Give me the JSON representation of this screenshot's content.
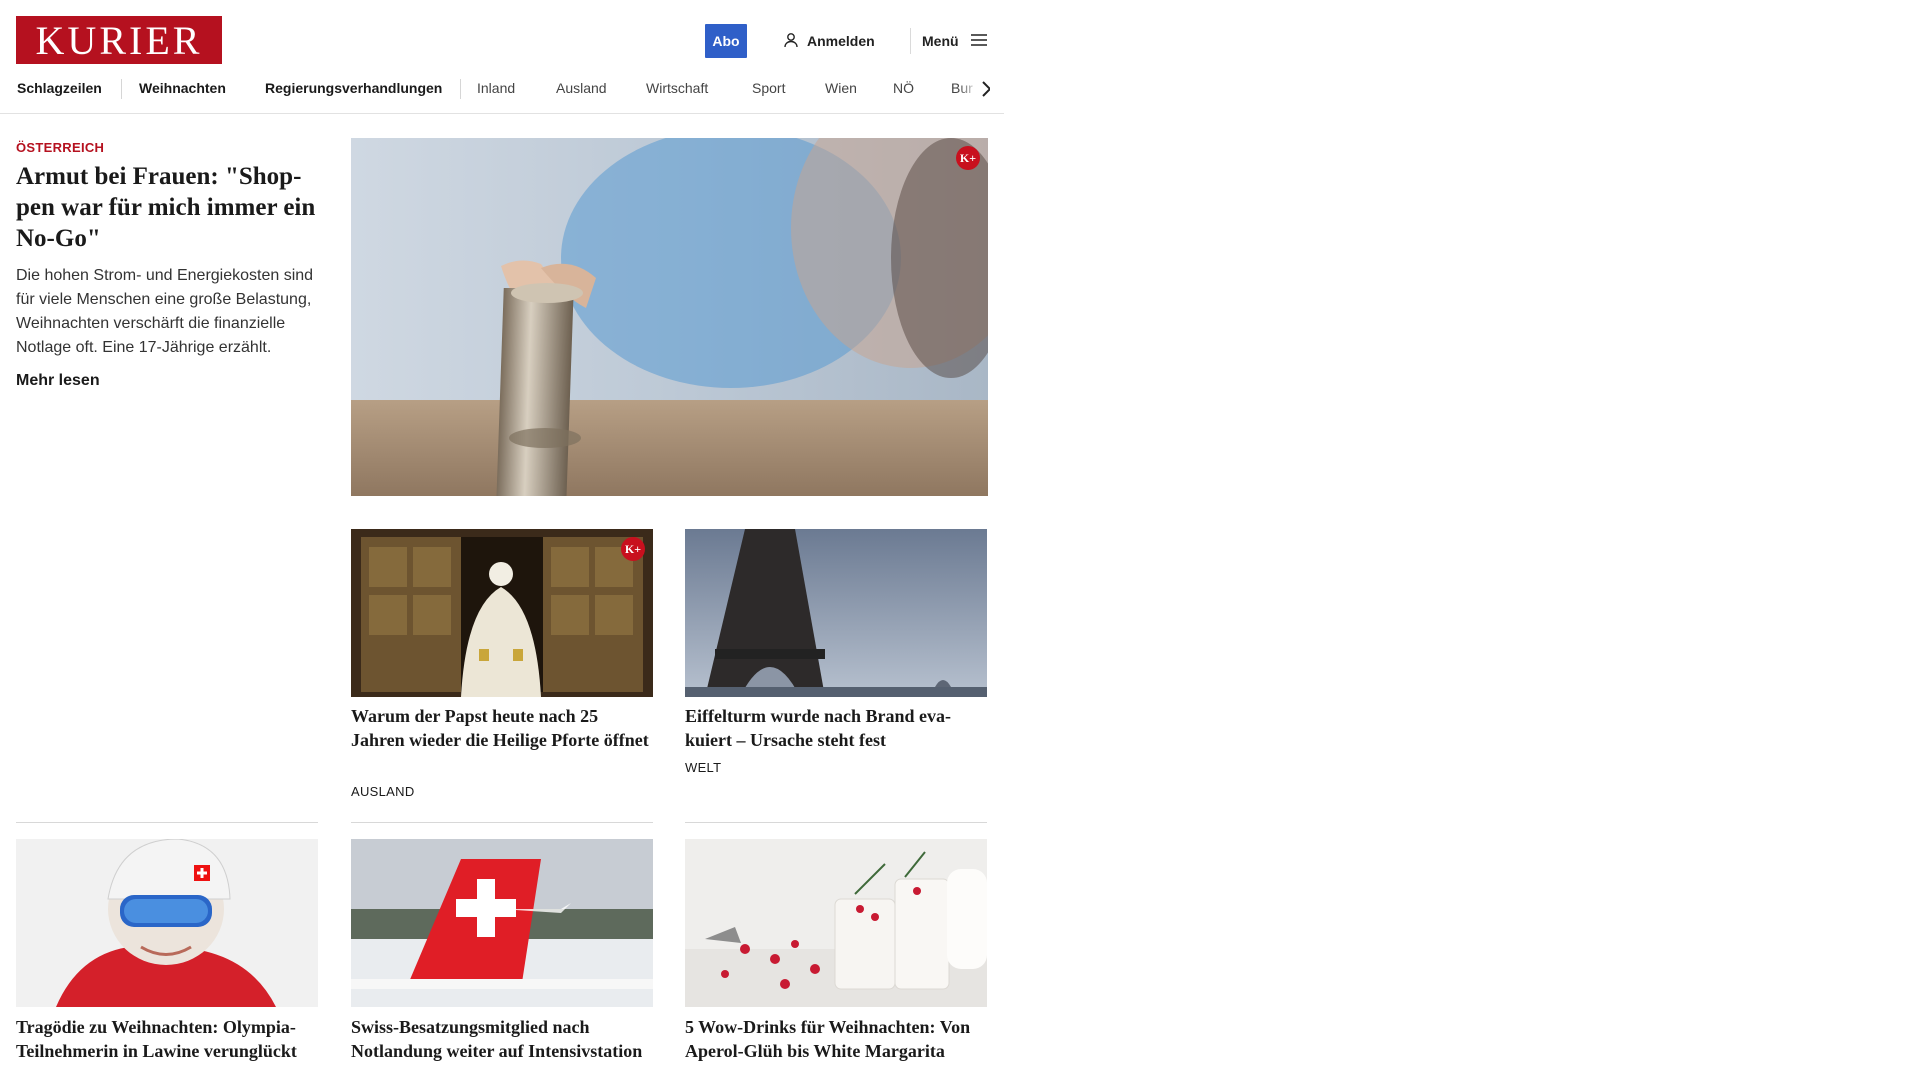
{
  "header": {
    "logo": "KURIER",
    "abo_label": "Abo",
    "login_label": "Anmelden",
    "menu_label": "Menü"
  },
  "nav": {
    "items": [
      "Schlagzeilen",
      "Weihnachten",
      "Regierungsverhandlungen",
      "Inland",
      "Ausland",
      "Wirtschaft",
      "Sport",
      "Wien",
      "NÖ",
      "Bur"
    ]
  },
  "lead": {
    "kicker": "ÖSTERREICH",
    "title": "Armut bei Frauen: \"Shop­pen war für mich immer ein No-Go\"",
    "teaser": "Die hohen Strom- und Energiekosten sind für viele Menschen eine große Belastung, Weihnachten verschärft die finanzielle Notlage oft. Eine 17-Jährige erzählt.",
    "more_label": "Mehr lesen",
    "badge": "K+"
  },
  "articles": [
    {
      "title": "Warum der Papst heute nach 25 Jahren wieder die Heilige Pforte öffnet",
      "category": "AUSLAND",
      "badge": "K+"
    },
    {
      "title": "Eiffelturm wurde nach Brand eva­kuiert – Ursache steht fest",
      "category": "WELT"
    },
    {
      "title": "Tragödie zu Weihnachten: Olym­pia-Teilnehmerin in Lawine verunglückt"
    },
    {
      "title": "Swiss-Besatzungsmitglied nach Notlandung weiter auf Intensivstation"
    },
    {
      "title": "5 Wow-Drinks für Weihnachten: Von Aperol-Glüh bis White Margarita"
    }
  ],
  "colors": {
    "brand_red": "#b5111f",
    "abo_blue": "#2f5fc8"
  }
}
